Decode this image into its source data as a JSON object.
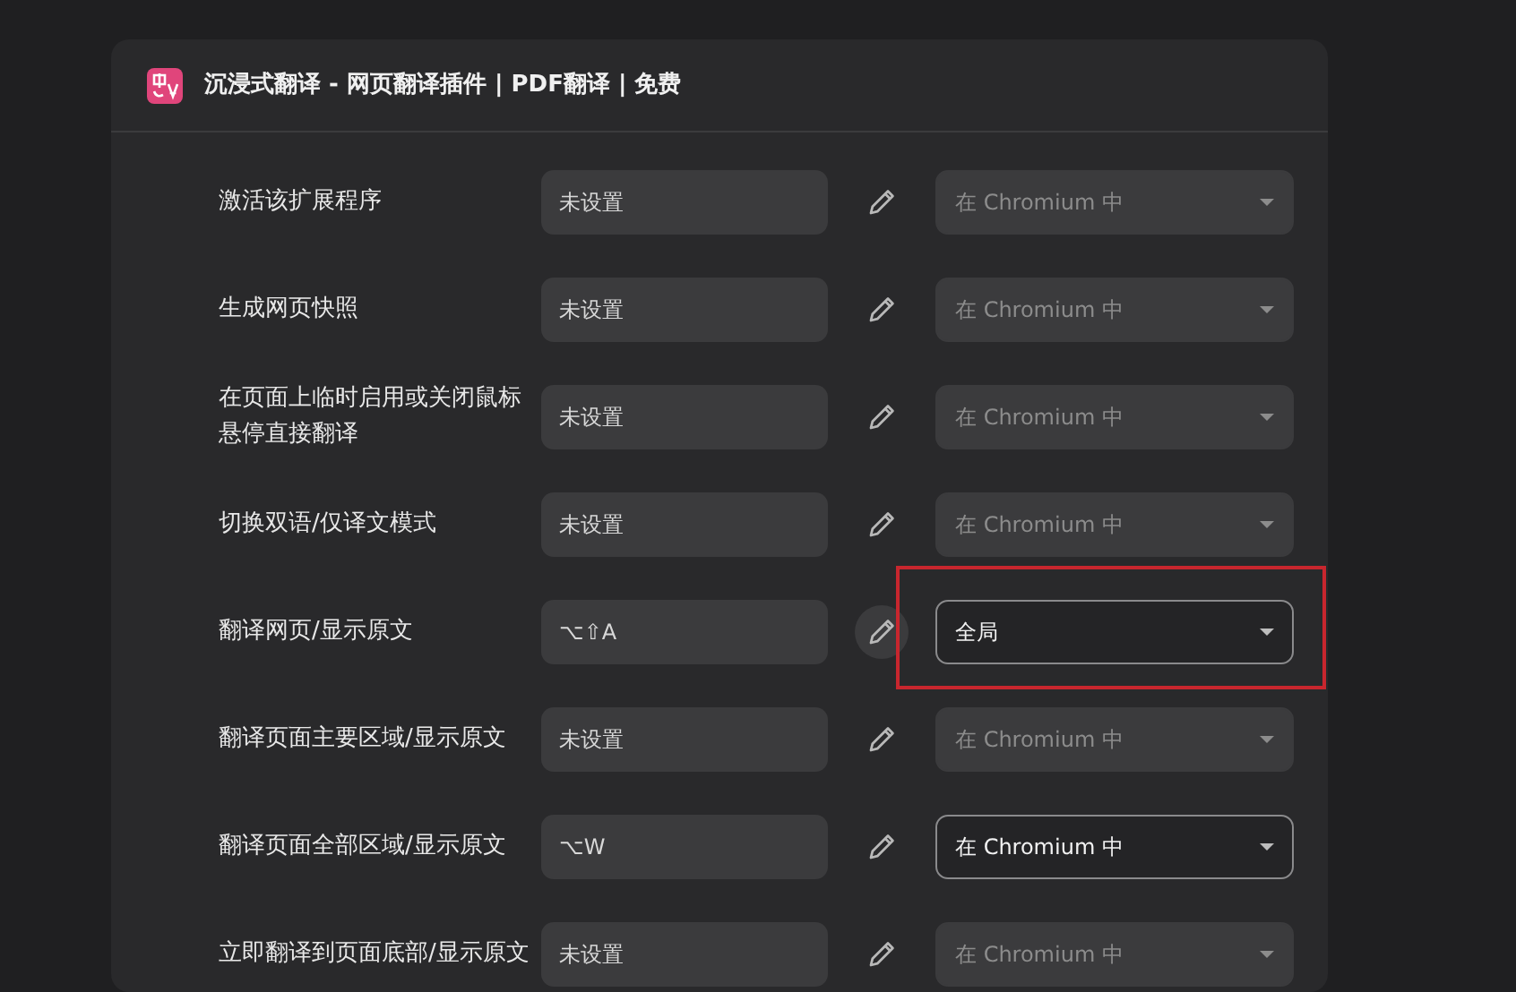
{
  "card": {
    "title": "沉浸式翻译 - 网页翻译插件 | PDF翻译 | 免费",
    "rows": [
      {
        "label": "激活该扩展程序",
        "shortcut": "未设置",
        "edit_hovered": false,
        "scope": "在 Chromium 中",
        "scope_disabled": true,
        "highlighted": false
      },
      {
        "label": "生成网页快照",
        "shortcut": "未设置",
        "edit_hovered": false,
        "scope": "在 Chromium 中",
        "scope_disabled": true,
        "highlighted": false
      },
      {
        "label": "在页面上临时启用或关闭鼠标悬停直接翻译",
        "shortcut": "未设置",
        "edit_hovered": false,
        "scope": "在 Chromium 中",
        "scope_disabled": true,
        "highlighted": false
      },
      {
        "label": "切换双语/仅译文模式",
        "shortcut": "未设置",
        "edit_hovered": false,
        "scope": "在 Chromium 中",
        "scope_disabled": true,
        "highlighted": false
      },
      {
        "label": "翻译网页/显示原文",
        "shortcut": "⌥⇧A",
        "edit_hovered": true,
        "scope": "全局",
        "scope_disabled": false,
        "highlighted": true
      },
      {
        "label": "翻译页面主要区域/显示原文",
        "shortcut": "未设置",
        "edit_hovered": false,
        "scope": "在 Chromium 中",
        "scope_disabled": true,
        "highlighted": false
      },
      {
        "label": "翻译页面全部区域/显示原文",
        "shortcut": "⌥W",
        "edit_hovered": false,
        "scope": "在 Chromium 中",
        "scope_disabled": false,
        "highlighted": false
      },
      {
        "label": "立即翻译到页面底部/显示原文",
        "shortcut": "未设置",
        "edit_hovered": false,
        "scope": "在 Chromium 中",
        "scope_disabled": true,
        "highlighted": false
      }
    ]
  }
}
